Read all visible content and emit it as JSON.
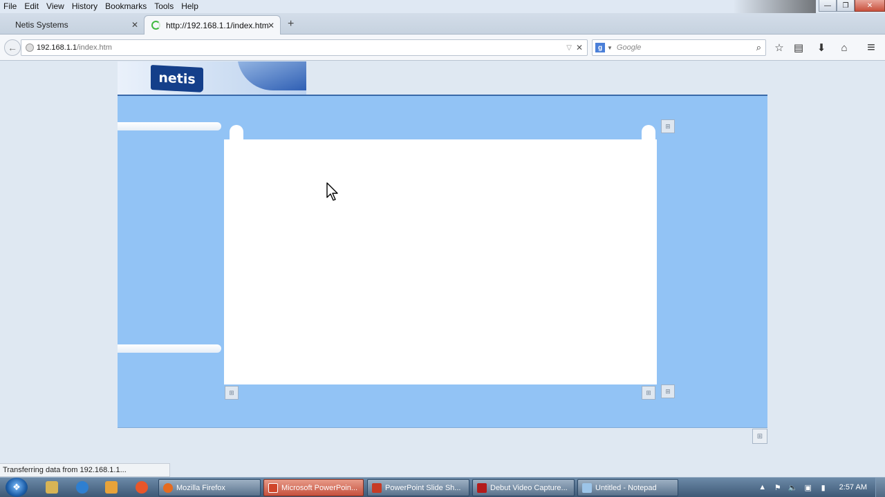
{
  "menu": {
    "items": [
      "File",
      "Edit",
      "View",
      "History",
      "Bookmarks",
      "Tools",
      "Help"
    ]
  },
  "window_controls": {
    "minimize": "—",
    "restore": "❐",
    "close": "✕"
  },
  "tabs": [
    {
      "title": "Netis Systems",
      "active": false
    },
    {
      "title": "http://192.168.1.1/index.htm",
      "active": true,
      "loading": true
    }
  ],
  "tab_close_glyph": "✕",
  "new_tab_glyph": "+",
  "navbar": {
    "back_glyph": "←",
    "url_host": "192.168.1.1",
    "url_path": "/index.htm",
    "dropdown_glyph": "▽",
    "clear_glyph": "✕"
  },
  "search": {
    "engine_letter": "g",
    "placeholder": "Google",
    "dropdown": "▼",
    "go_glyph": "⌕"
  },
  "toolbar_icons": {
    "bookmark": "☆",
    "reading_list": "▤",
    "download": "⬇",
    "home": "⌂",
    "menu": "≡"
  },
  "page": {
    "logo_text": "netis",
    "broken_image_glyph": "⊞"
  },
  "status": {
    "text": "Transferring data from 192.168.1.1..."
  },
  "taskbar": {
    "start_glyph": "❖",
    "buttons": [
      {
        "label": "Mozilla Firefox",
        "icon_color": "#e66b1f",
        "active": false
      },
      {
        "label": "Microsoft PowerPoin...",
        "icon_color": "#d0452a",
        "active": true
      },
      {
        "label": "PowerPoint Slide Sh...",
        "icon_color": "#c63b26",
        "active": false
      },
      {
        "label": "Debut Video Capture...",
        "icon_color": "#b31b1b",
        "active": false
      },
      {
        "label": "Untitled - Notepad",
        "icon_color": "#9cc4e8",
        "active": false
      }
    ],
    "tray": {
      "arrow": "▲",
      "flag": "⚑",
      "volume": "🔈",
      "network": "▣",
      "power": "▮",
      "clock": "2:57 AM"
    }
  },
  "colors": {
    "panel_blue": "#92c3f5",
    "logo_navy": "#143f8a",
    "page_bg": "#dfe8f2"
  }
}
